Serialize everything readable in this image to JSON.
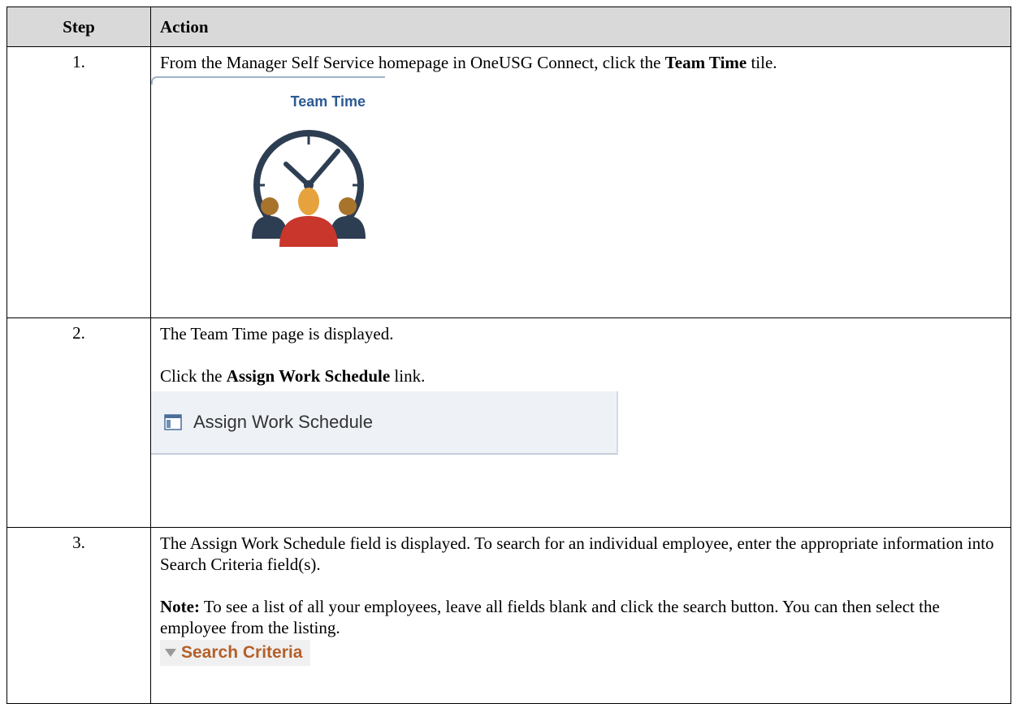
{
  "headers": {
    "step": "Step",
    "action": "Action"
  },
  "rows": [
    {
      "step": "1.",
      "text_before": "From the Manager Self Service homepage in OneUSG Connect, click the ",
      "text_bold": "Team Time",
      "text_after": " tile.",
      "tile": {
        "title": "Team Time",
        "icon": "clock-team-icon"
      }
    },
    {
      "step": "2.",
      "line1": "The Team Time page is displayed.",
      "text_before": "Click the ",
      "text_bold": "Assign Work Schedule",
      "text_after": " link.",
      "link": {
        "label": "Assign Work Schedule",
        "icon": "schedule-page-icon"
      }
    },
    {
      "step": "3.",
      "line1": "The Assign Work Schedule field is displayed. To search for an individual employee, enter the appropriate information into Search Criteria field(s).",
      "note_label": "Note:",
      "note_text": " To see a list of all your employees, leave all fields blank and click the search button. You can then select the employee from the listing.",
      "search": {
        "label": "Search Criteria",
        "icon": "collapse-triangle-icon"
      }
    }
  ],
  "colors": {
    "header_bg": "#d9d9d9",
    "tile_title": "#2c5a94",
    "search_label": "#b4602a",
    "link_bar_bg": "#eef2f7"
  }
}
